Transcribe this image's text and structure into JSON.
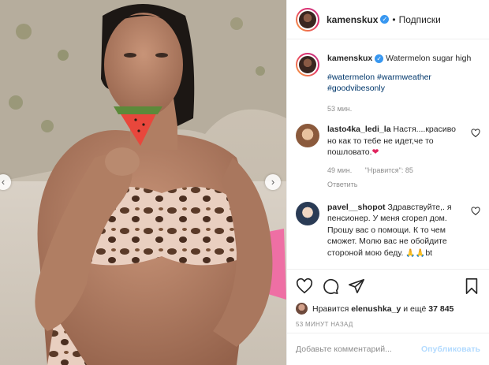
{
  "post": {
    "author": "kamenskux",
    "follow_label": "Подписки",
    "dot": "•",
    "verified_glyph": "✓"
  },
  "caption": {
    "user": "kamenskux",
    "text": "Watermelon sugar high",
    "hashtags": [
      "#watermelon",
      "#warmweather",
      "#goodvibesonly"
    ],
    "time": "53 мин."
  },
  "comments": [
    {
      "user": "lasto4ka_ledi_la",
      "text": "Настя....красиво но как то тебе не идет,че то пошловато.",
      "emoji": "❤",
      "time": "49 мин.",
      "likes": "\"Нравится\": 85",
      "reply": "Ответить"
    },
    {
      "user": "pavel__shopot",
      "text": "Здравствуйте,. я пенсионер. У меня сгорел дом. Прошу вас о помощи. К то чем сможет. Молю вас не обойдите стороной мою беду.",
      "emoji": "🙏🙏",
      "suffix": "bt"
    }
  ],
  "likes": {
    "prefix": "Нравится",
    "user": "elenushka_y",
    "suffix": "и ещё",
    "count": "37 845"
  },
  "timestamp": "53 МИНУТ НАЗАД",
  "composer": {
    "placeholder": "Добавьте комментарий...",
    "publish_label": "Опубликовать"
  },
  "colors": {
    "link": "#00376b",
    "muted": "#8e8e8e",
    "verified": "#3897f0",
    "publish_disabled": "#b3dbff"
  },
  "icons": [
    "heart-icon",
    "comment-icon",
    "share-icon",
    "bookmark-icon",
    "chevron-left-icon",
    "chevron-right-icon"
  ]
}
